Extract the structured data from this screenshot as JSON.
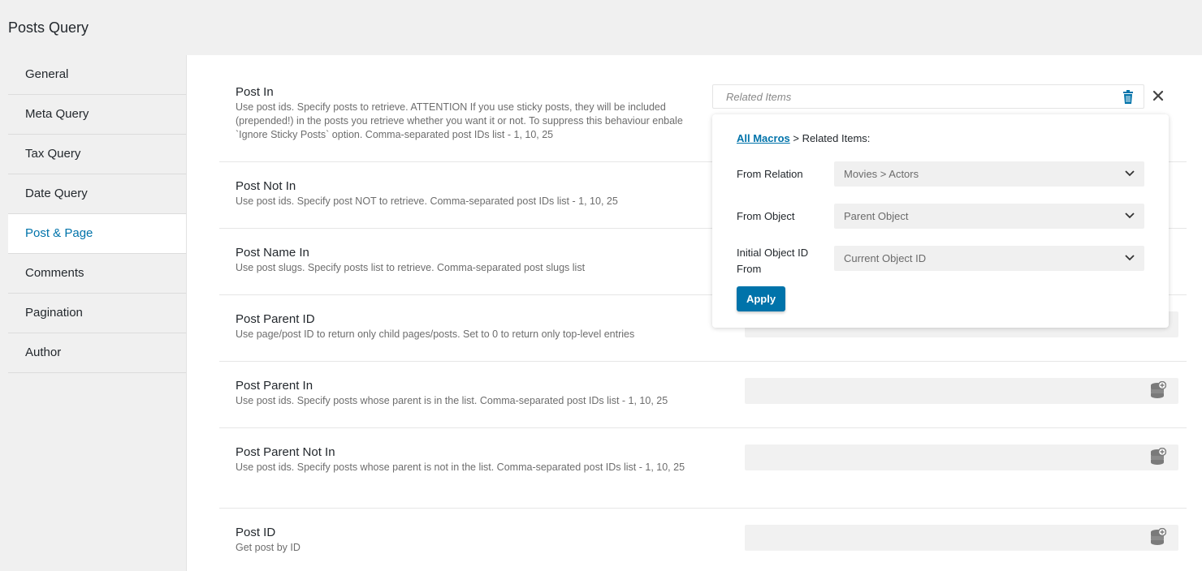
{
  "page_title": "Posts Query",
  "sidebar": {
    "items": [
      {
        "label": "General"
      },
      {
        "label": "Meta Query"
      },
      {
        "label": "Tax Query"
      },
      {
        "label": "Date Query"
      },
      {
        "label": "Post & Page"
      },
      {
        "label": "Comments"
      },
      {
        "label": "Pagination"
      },
      {
        "label": "Author"
      }
    ],
    "active": "Post & Page"
  },
  "fields": [
    {
      "label": "Post In",
      "desc": "Use post ids. Specify posts to retrieve. ATTENTION If you use sticky posts, they will be included (prepended!) in the posts you retrieve whether you want it or not. To suppress this behaviour enbale `Ignore Sticky Posts` option. Comma-separated post IDs list - 1, 10, 25"
    },
    {
      "label": "Post Not In",
      "desc": "Use post ids. Specify post NOT to retrieve. Comma-separated post IDs list - 1, 10, 25"
    },
    {
      "label": "Post Name In",
      "desc": "Use post slugs. Specify posts list to retrieve. Comma-separated post slugs list"
    },
    {
      "label": "Post Parent ID",
      "desc": "Use page/post ID to return only child pages/posts. Set to 0 to return only top-level entries"
    },
    {
      "label": "Post Parent In",
      "desc": "Use post ids. Specify posts whose parent is in the list. Comma-separated post IDs list - 1, 10, 25"
    },
    {
      "label": "Post Parent Not In",
      "desc": "Use post ids. Specify posts whose parent is not in the list. Comma-separated post IDs list - 1, 10, 25"
    },
    {
      "label": "Post ID",
      "desc": "Get post by ID"
    }
  ],
  "macro_input": {
    "placeholder": "Related Items"
  },
  "macro_popup": {
    "all_macros_link": "All Macros",
    "crumb_rest": " > Related Items:",
    "from_relation": {
      "label": "From Relation",
      "value": "Movies > Actors"
    },
    "from_object": {
      "label": "From Object",
      "value": "Parent Object"
    },
    "initial_object": {
      "label": "Initial Object ID From",
      "value": "Current Object ID"
    },
    "apply_label": "Apply"
  },
  "colors": {
    "accent": "#0073aa",
    "field_bg": "#f1f1f1",
    "sidebar_bg": "#f0f0f0"
  },
  "icons": [
    "trash-icon",
    "close-icon",
    "database-add-icon",
    "chevron-down-icon"
  ]
}
